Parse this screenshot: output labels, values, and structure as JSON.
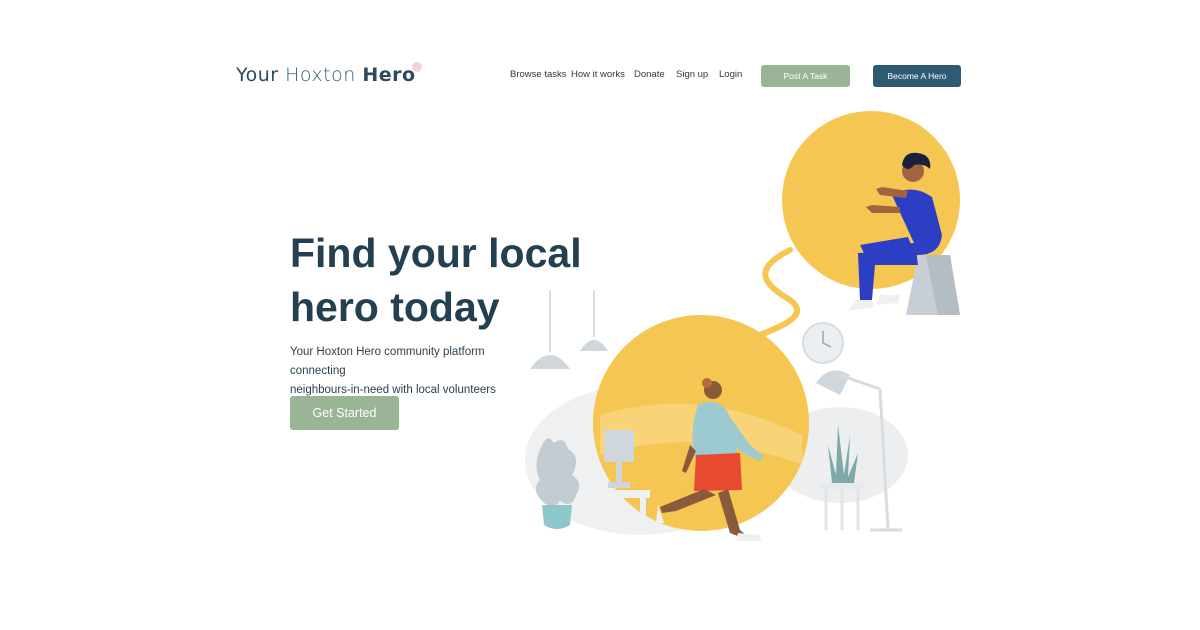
{
  "logo": {
    "word1": "Your",
    "word2": "Hoxton",
    "word3": "Hero"
  },
  "nav": {
    "items": [
      "Browse tasks",
      "How it works",
      "Donate",
      "Sign up",
      "Login"
    ]
  },
  "buttons": {
    "post_task": "Post A Task",
    "become_hero": "Become A Hero"
  },
  "hero": {
    "headline_line1": "Find your local",
    "headline_line2": "hero today",
    "sub_line1": "Your Hoxton Hero community platform connecting",
    "sub_line2": "neighbours-in-need with local volunteers",
    "cta": "Get Started"
  },
  "colors": {
    "brand_navy": "#2f5a74",
    "brand_sage": "#9ab496",
    "accent_yellow": "#f6c653",
    "text_dark": "#243f4f"
  },
  "icons": [
    "hero-illustration",
    "sitting-person",
    "running-person",
    "wall-clock-icon",
    "pendant-lamps",
    "floor-lamp",
    "potted-plant",
    "side-table"
  ]
}
